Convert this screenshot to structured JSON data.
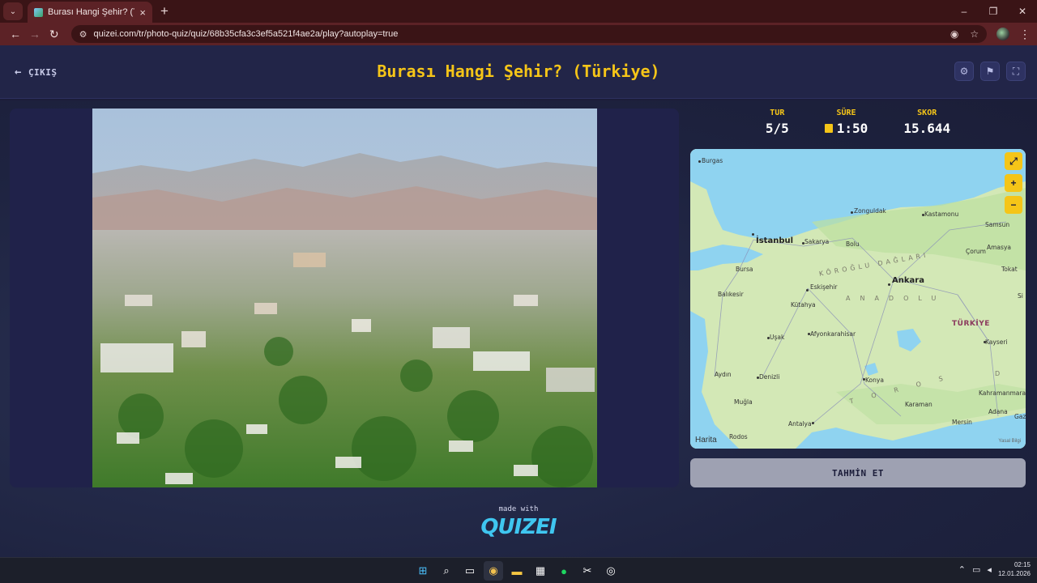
{
  "browser": {
    "tab_title": "Burası Hangi Şehir? (Türkiye) - Q",
    "url": "quizei.com/tr/photo-quiz/quiz/68b35cfa3c3ef5a521f4ae2a/play?autoplay=true"
  },
  "header": {
    "exit_label": "ÇIKIŞ",
    "title": "Burası Hangi Şehir? (Türkiye)"
  },
  "stats": {
    "round_label": "TUR",
    "round_value": "5/5",
    "time_label": "SÜRE",
    "time_value": "1:50",
    "score_label": "SKOR",
    "score_value": "15.644"
  },
  "map": {
    "brand": "Harita",
    "legal": "Yasal Bilgi",
    "labels": {
      "burgas": "Burgas",
      "istanbul": "İstanbul",
      "sakarya": "Sakarya",
      "bolu": "Bolu",
      "zonguldak": "Zonguldak",
      "kastamonu": "Kastamonu",
      "samsun": "Samsun",
      "amasya": "Amasya",
      "corum": "Çorum",
      "tokat": "Tokat",
      "bursa": "Bursa",
      "balikesir": "Balıkesir",
      "eskisehir": "Eskişehir",
      "kutahya": "Kütahya",
      "ankara": "Ankara",
      "usak": "Uşak",
      "afyon": "Afyonkarahisar",
      "kayseri": "Kayseri",
      "aydin": "Aydın",
      "denizli": "Denizli",
      "konya": "Konya",
      "mugla": "Muğla",
      "kahramanmaras": "Kahramanmara",
      "karaman": "Karaman",
      "adana": "Adana",
      "antalya": "Antalya",
      "mersin": "Mersin",
      "rodos": "Rodos",
      "turkiye": "TÜRKİYE",
      "koroglu": "KÖROĞLU DAĞLARI",
      "anadolu": "ANADOLU",
      "toros": "T O R O S",
      "d": "D",
      "gaz": "Gaz",
      "si": "Si"
    }
  },
  "guess_label": "TAHMİN ET",
  "footer": {
    "made_with": "made with",
    "brand": "QUIZEI"
  },
  "taskbar": {
    "time": "02:15",
    "date": "12.01.2026"
  },
  "colors": {
    "accent": "#f5c518",
    "page_bg": "#1c1d3a",
    "browser_frame": "#5c2226"
  }
}
